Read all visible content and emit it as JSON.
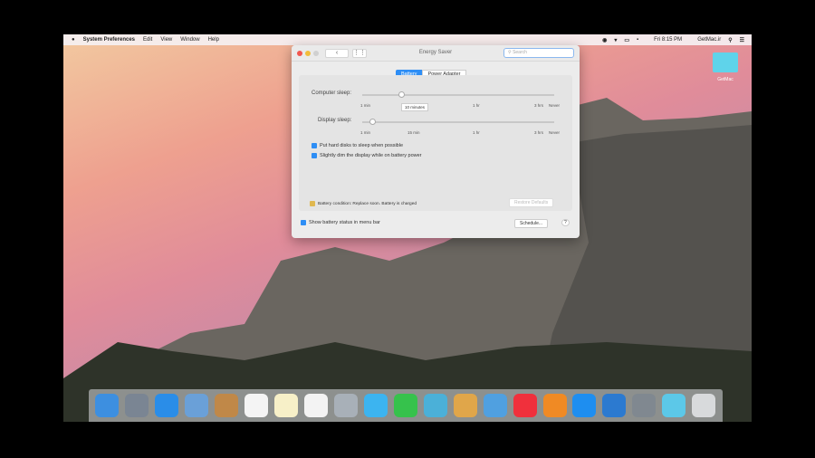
{
  "menubar": {
    "apple": "",
    "app": "System Preferences",
    "items": [
      "Edit",
      "View",
      "Window",
      "Help"
    ],
    "clock": "Fri 8:15 PM",
    "user": "GetMac.ir"
  },
  "desktop": {
    "folder_label": "GetMac"
  },
  "window": {
    "title": "Energy Saver",
    "search_placeholder": "Search",
    "tabs": [
      "Battery",
      "Power Adapter"
    ],
    "active_tab": "Battery",
    "computer_sleep": {
      "label": "Computer sleep:",
      "value": "10 minutes",
      "ticks": [
        "1 min",
        "1 hr",
        "3 hrs",
        "Never"
      ]
    },
    "display_sleep": {
      "label": "Display sleep:",
      "value": "2 min",
      "ticks": [
        "1 min",
        "15 min",
        "1 hr",
        "3 hrs",
        "Never"
      ]
    },
    "checkboxes": [
      {
        "label": "Put hard disks to sleep when possible",
        "checked": true
      },
      {
        "label": "Slightly dim the display while on battery power",
        "checked": true
      }
    ],
    "battery_status": "Battery condition: Replace soon. Battery is charged",
    "restore_defaults": "Restore Defaults",
    "show_battery": {
      "label": "Show battery status in menu bar",
      "checked": true
    },
    "schedule": "Schedule...",
    "help": "?"
  },
  "dock": {
    "colors": [
      "#3d8fe0",
      "#7a8593",
      "#2a8de8",
      "#6aa0d8",
      "#c08848",
      "#f4f4f4",
      "#f7f0c8",
      "#f3f3f3",
      "#a8b0b8",
      "#3cb4f0",
      "#36c24c",
      "#4bb0d8",
      "#e0a64a",
      "#50a0e0",
      "#f0303c",
      "#f08a24",
      "#1e8ef0",
      "#2c7ad0",
      "#808890",
      "#5cc8e8",
      "#d8dadc"
    ]
  }
}
